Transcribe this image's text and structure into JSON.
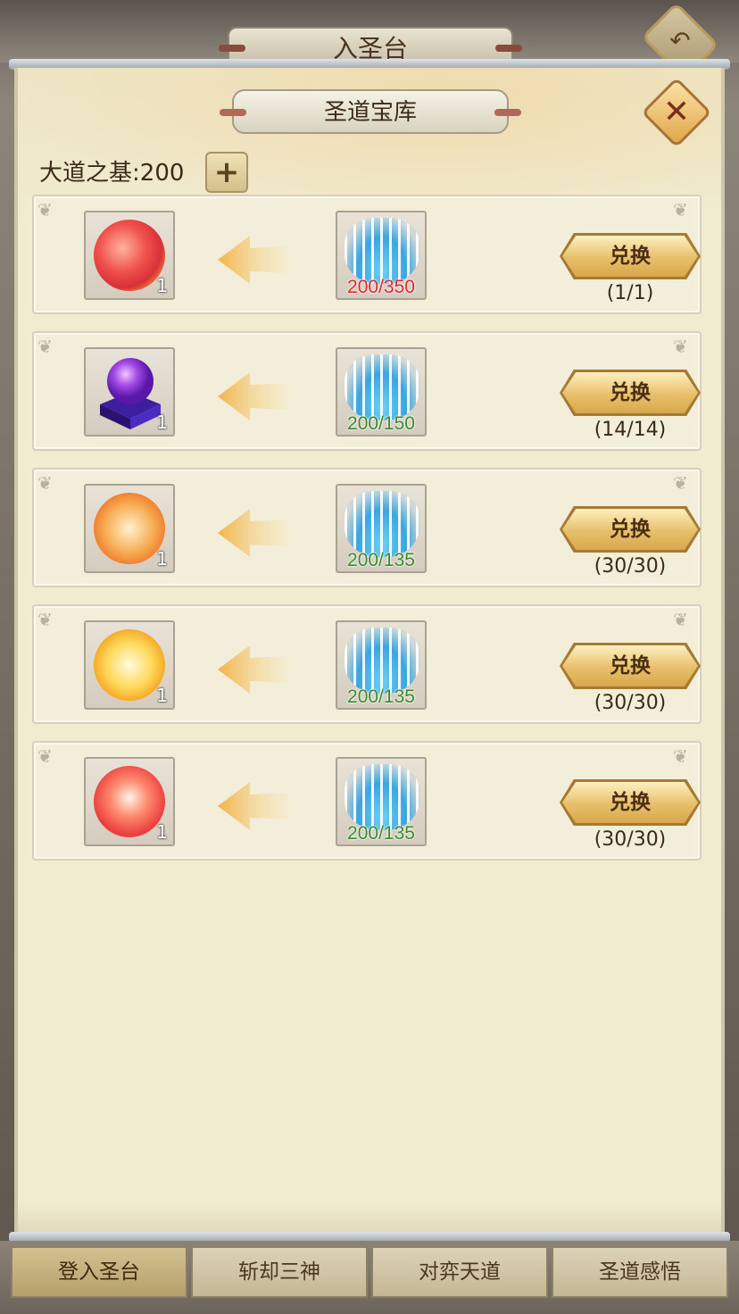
{
  "header": {
    "title": "入圣台",
    "back_icon": "back-arrow-icon"
  },
  "popup": {
    "title": "圣道宝库",
    "close_icon": "close-icon",
    "currency_label": "大道之基",
    "currency_separator": ":",
    "currency_value": "200",
    "add_label": "+"
  },
  "rows": [
    {
      "reward_icon": "red-flame-orb-icon",
      "reward_qty": "1",
      "cost_icon": "spirit-fountain-icon",
      "cost_text": "200/350",
      "cost_color": "#e0262a",
      "button_label": "兑换",
      "limit": "(1/1)"
    },
    {
      "reward_icon": "purple-crystal-ball-icon",
      "reward_qty": "1",
      "cost_icon": "spirit-fountain-icon",
      "cost_text": "200/150",
      "cost_color": "#3b8a2e",
      "button_label": "兑换",
      "limit": "(14/14)"
    },
    {
      "reward_icon": "orange-sword-orb-icon",
      "reward_qty": "1",
      "cost_icon": "spirit-fountain-icon",
      "cost_text": "200/135",
      "cost_color": "#3b8a2e",
      "button_label": "兑换",
      "limit": "(30/30)"
    },
    {
      "reward_icon": "yellow-shield-orb-icon",
      "reward_qty": "1",
      "cost_icon": "spirit-fountain-icon",
      "cost_text": "200/135",
      "cost_color": "#3b8a2e",
      "button_label": "兑换",
      "limit": "(30/30)"
    },
    {
      "reward_icon": "red-drop-orb-icon",
      "reward_qty": "1",
      "cost_icon": "spirit-fountain-icon",
      "cost_text": "200/135",
      "cost_color": "#3b8a2e",
      "button_label": "兑换",
      "limit": "(30/30)"
    }
  ],
  "tabs": [
    {
      "label": "登入圣台",
      "active": true
    },
    {
      "label": "斩却三神",
      "active": false
    },
    {
      "label": "对弈天道",
      "active": false
    },
    {
      "label": "圣道感悟",
      "active": false
    }
  ]
}
